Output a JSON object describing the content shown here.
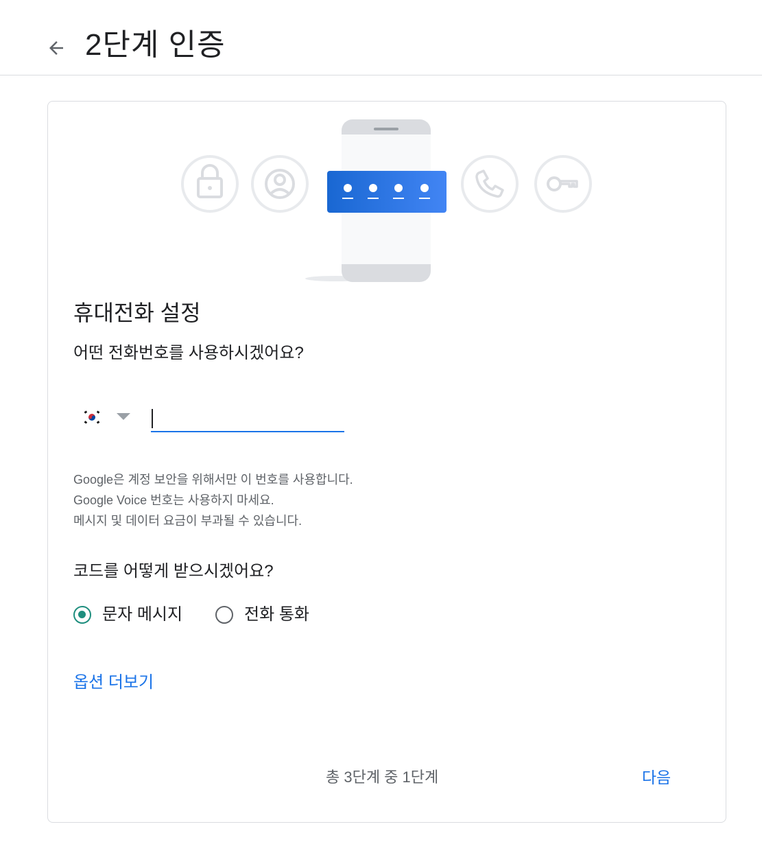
{
  "header": {
    "back_icon": "arrow-back-icon",
    "title": "2단계 인증"
  },
  "illustration": {
    "icons": [
      "lock-icon",
      "account-circle-icon",
      "phone-icon",
      "key-icon"
    ],
    "code_dots": 4,
    "accent_color": "#1a73e8"
  },
  "setup": {
    "section_title": "휴대전화 설정",
    "question": "어떤 전화번호를 사용하시겠어요?",
    "country": {
      "icon": "south-korea-flag-icon",
      "dropdown_icon": "triangle-down-icon"
    },
    "phone_input": {
      "value": "",
      "placeholder": ""
    },
    "notice_lines": [
      "Google은 계정 보안을 위해서만 이 번호를 사용합니다.",
      "Google Voice 번호는 사용하지 마세요.",
      "메시지 및 데이터 요금이 부과될 수 있습니다."
    ],
    "method_question": "코드를 어떻게 받으시겠어요?",
    "methods": [
      {
        "label": "문자 메시지",
        "selected": true
      },
      {
        "label": "전화 통화",
        "selected": false
      }
    ],
    "more_options": "옵션 더보기"
  },
  "footer": {
    "step_indicator": "총 3단계 중 1단계",
    "next_label": "다음"
  }
}
